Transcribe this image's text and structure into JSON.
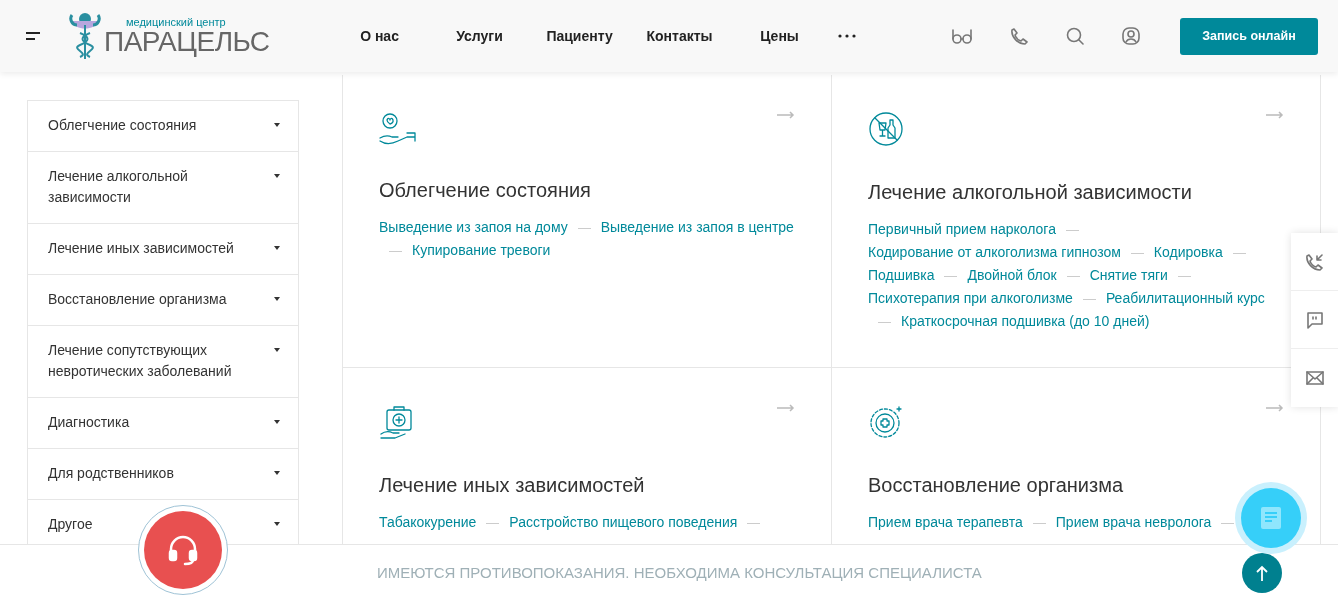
{
  "header": {
    "logo": {
      "caption": "медицинский центр",
      "name": "ПАРАЦЕЛЬС"
    },
    "nav": [
      "О нас",
      "Услуги",
      "Пациенту",
      "Контакты",
      "Цены"
    ],
    "cta": "Запись онлайн"
  },
  "sidebar": {
    "items": [
      {
        "label": "Облегчение состояния",
        "expanded": false
      },
      {
        "label": "Лечение алкогольной зависимости",
        "expanded": false
      },
      {
        "label": "Лечение иных зависимостей",
        "expanded": false
      },
      {
        "label": "Восстановление организма",
        "expanded": false
      },
      {
        "label": "Лечение сопутствующих невротических заболеваний",
        "expanded": false
      },
      {
        "label": "Диагностика",
        "expanded": false
      },
      {
        "label": "Для родственников",
        "expanded": false
      },
      {
        "label": "Другое",
        "expanded": false
      }
    ]
  },
  "cards": [
    {
      "kind": "heart",
      "title": "Облегчение состояния",
      "links": [
        "Выведение из запоя на дому",
        "Выведение из запоя в центре",
        "Купирование тревоги"
      ]
    },
    {
      "kind": "bottle",
      "title": "Лечение алкогольной зависимости",
      "links": [
        "Первичный прием нарколога",
        "Кодирование от алкоголизма гипнозом",
        "Кодировка",
        "Подшивка",
        "Двойной блок",
        "Снятие тяги",
        "Психотерапия при алкоголизме",
        "Реабилитационный курс",
        "Краткосрочная подшивка (до 10 дней)"
      ]
    },
    {
      "kind": "kit",
      "title": "Лечение иных зависимостей",
      "links": [
        "Табакокурение",
        "Расстройство пищевого поведения"
      ]
    },
    {
      "kind": "target",
      "title": "Восстановление организма",
      "links": [
        "Прием врача терапевта",
        "Прием врача невролога"
      ]
    }
  ],
  "footer": {
    "notice": "ИМЕЮТСЯ ПРОТИВОПОКАЗАНИЯ. НЕОБХОДИМА КОНСУЛЬТАЦИЯ СПЕЦИАЛИСТА"
  }
}
